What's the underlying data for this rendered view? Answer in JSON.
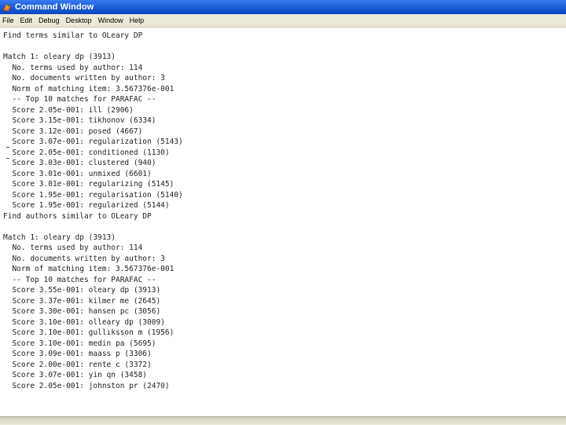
{
  "window": {
    "title": "Command Window"
  },
  "menu": [
    "File",
    "Edit",
    "Debug",
    "Desktop",
    "Window",
    "Help"
  ],
  "console": {
    "lines": [
      "Find terms similar to OLeary DP",
      "",
      "Match 1: oleary dp (3913)",
      "  No. terms used by author: 114",
      "  No. documents written by author: 3",
      "  Norm of matching item: 3.567376e-001",
      "  -- Top 10 matches for PARAFAC --",
      "  Score 2.05e-001: ill (2906)",
      "  Score 3.15e-001: tikhonov (6334)",
      "  Score 3.12e-001: posed (4667)",
      "  Score 3.07e-001: regularization (5143)",
      "  Score 2.05e-001: conditioned (1130)",
      "  Score 3.03e-001: clustered (940)",
      "  Score 3.01e-001: unmixed (6601)",
      "  Score 3.01e-001: regularizing (5145)",
      "  Score 1.95e-001: regularisation (5140)",
      "  Score 1.95e-001: regularized (5144)",
      "Find authors similar to OLeary DP",
      "",
      "Match 1: oleary dp (3913)",
      "  No. terms used by author: 114",
      "  No. documents written by author: 3",
      "  Norm of matching item: 3.567376e-001",
      "  -- Top 10 matches for PARAFAC --",
      "  Score 3.55e-001: oleary dp (3913)",
      "  Score 3.37e-001: kilmer me (2645)",
      "  Score 3.30e-001: hansen pc (3056)",
      "  Score 3.10e-001: olleary dp (3009)",
      "  Score 3.10e-001: gullıksson m (1956)",
      "  Score 3.10e-001: medin pa (5695)",
      "  Score 3.09e-001: maass p (3306)",
      "  Score 2.00e-001: rente c (3372)",
      "  Score 3.07e-001: yin qn (3458)",
      "  Score 2.05e-001: johnston pr (2470)"
    ]
  }
}
